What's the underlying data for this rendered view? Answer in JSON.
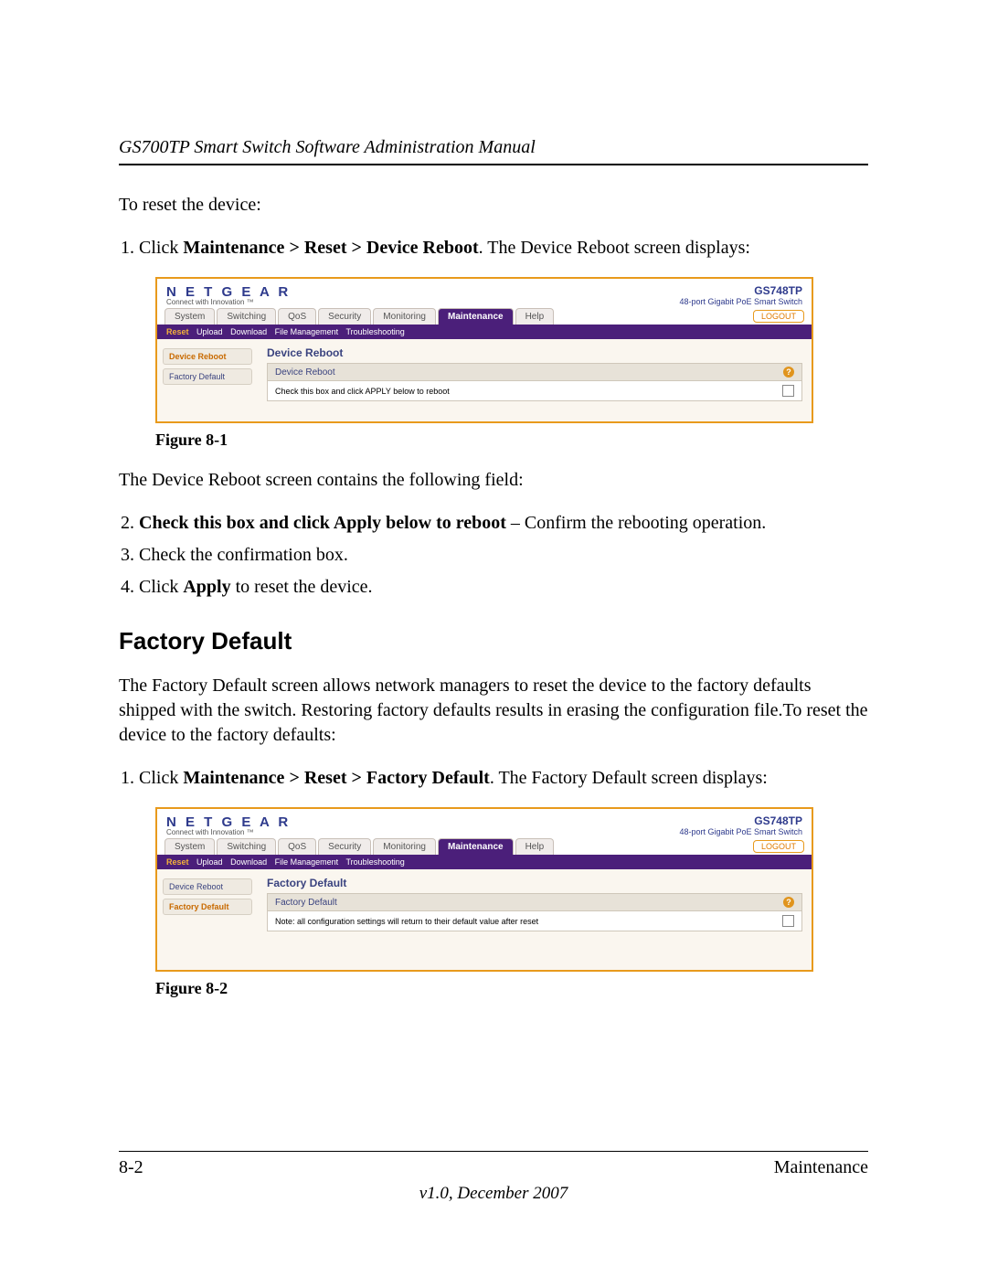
{
  "header": {
    "doc_title": "GS700TP Smart Switch Software Administration Manual"
  },
  "intro": "To reset the device:",
  "step1_pre": "Click ",
  "step1_bold": "Maintenance > Reset > Device Reboot",
  "step1_post": ". The Device Reboot screen displays:",
  "fig1_cap": "Figure 8-1",
  "after_fig1": "The Device Reboot screen contains the following field:",
  "step2_bold": "Check this box and click Apply below to reboot",
  "step2_post": " – Confirm the rebooting operation.",
  "step3": "Check the confirmation box.",
  "step4_pre": "Click ",
  "step4_bold": "Apply",
  "step4_post": " to reset the device.",
  "section_title": "Factory Default",
  "fd_para": "The Factory Default screen allows network managers to reset the device to the factory defaults shipped with the switch. Restoring factory defaults results in erasing the configuration file.To reset the device to the factory defaults:",
  "fd_step1_pre": "Click ",
  "fd_step1_bold": "Maintenance > Reset > Factory Default",
  "fd_step1_post": ". The Factory Default screen displays:",
  "fig2_cap": "Figure 8-2",
  "footer": {
    "page": "8-2",
    "chapter": "Maintenance",
    "version": "v1.0, December 2007"
  },
  "ui": {
    "brand": "N E T G E A R",
    "tagline": "Connect with Innovation ™",
    "model": "GS748TP",
    "model_sub": "48-port Gigabit PoE Smart Switch",
    "tabs": [
      "System",
      "Switching",
      "QoS",
      "Security",
      "Monitoring",
      "Maintenance",
      "Help"
    ],
    "active_tab": "Maintenance",
    "logout": "LOGOUT",
    "subnav": [
      "Reset",
      "Upload",
      "Download",
      "File Management",
      "Troubleshooting"
    ],
    "subnav_active": "Reset",
    "side_items": [
      "Device Reboot",
      "Factory Default"
    ],
    "shot1": {
      "side_active": "Device Reboot",
      "panel_title": "Device Reboot",
      "panel_hd": "Device Reboot",
      "panel_text": "Check this box and click APPLY below to reboot"
    },
    "shot2": {
      "side_active": "Factory Default",
      "panel_title": "Factory Default",
      "panel_hd": "Factory Default",
      "panel_text": "Note: all configuration settings will return to their default value after reset"
    }
  }
}
